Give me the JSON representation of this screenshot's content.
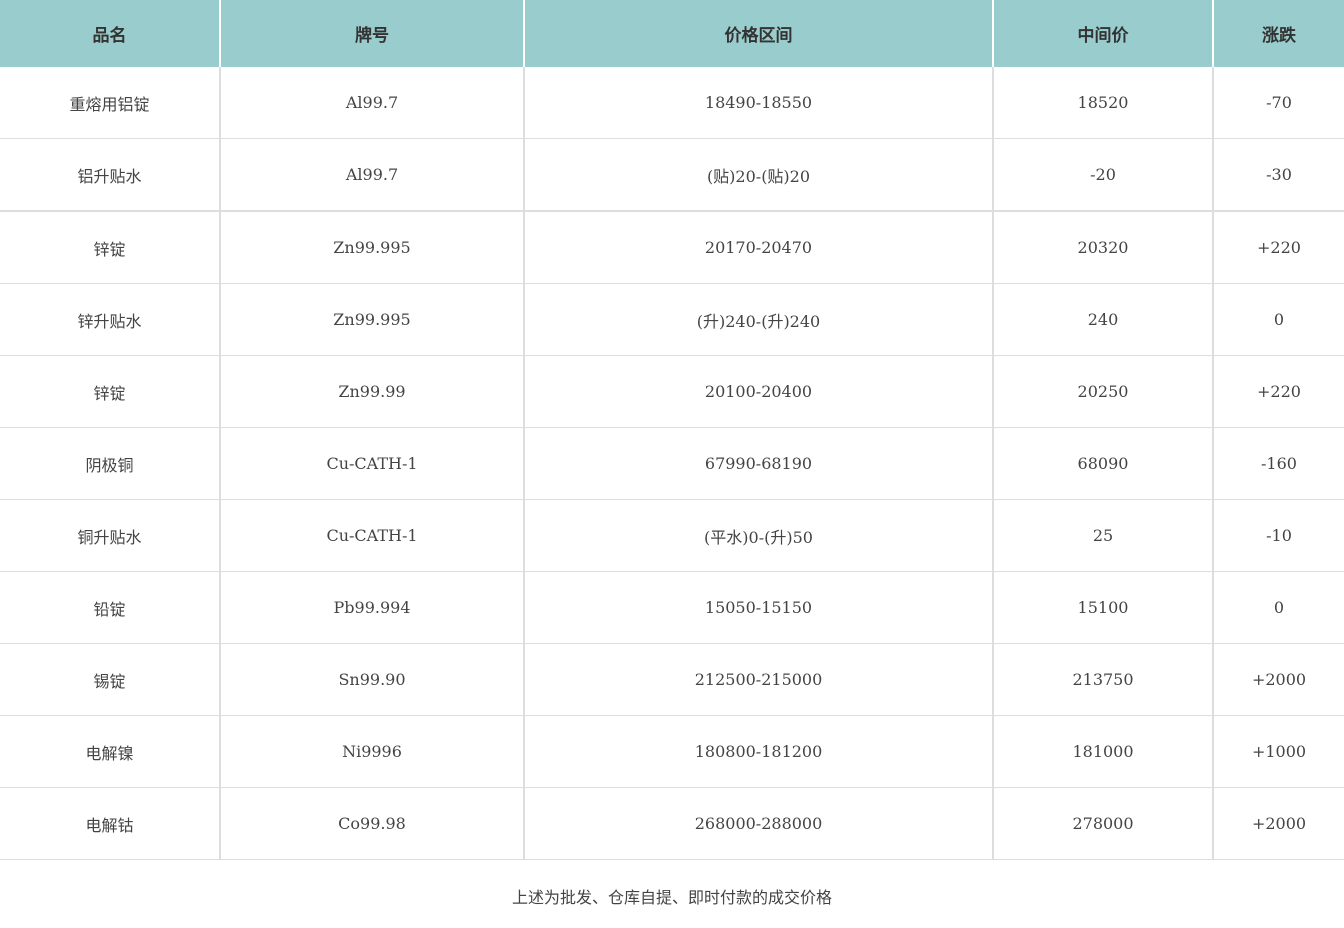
{
  "table": {
    "headers": [
      "品名",
      "牌号",
      "价格区间",
      "中间价",
      "涨跌"
    ],
    "rows": [
      [
        "重熔用铝锭",
        "Al99.7",
        "18490-18550",
        "18520",
        "-70"
      ],
      [
        "铝升贴水",
        "Al99.7",
        "(贴)20-(贴)20",
        "-20",
        "-30"
      ],
      [
        "锌锭",
        "Zn99.995",
        "20170-20470",
        "20320",
        "+220"
      ],
      [
        "锌升贴水",
        "Zn99.995",
        "(升)240-(升)240",
        "240",
        "0"
      ],
      [
        "锌锭",
        "Zn99.99",
        "20100-20400",
        "20250",
        "+220"
      ],
      [
        "阴极铜",
        "Cu-CATH-1",
        "67990-68190",
        "68090",
        "-160"
      ],
      [
        "铜升贴水",
        "Cu-CATH-1",
        "(平水)0-(升)50",
        "25",
        "-10"
      ],
      [
        "铅锭",
        "Pb99.994",
        "15050-15150",
        "15100",
        "0"
      ],
      [
        "锡锭",
        "Sn99.90",
        "212500-215000",
        "213750",
        "+2000"
      ],
      [
        "电解镍",
        "Ni9996",
        "180800-181200",
        "181000",
        "+1000"
      ],
      [
        "电解钴",
        "Co99.98",
        "268000-288000",
        "278000",
        "+2000"
      ]
    ]
  },
  "footer": {
    "note": "上述为批发、仓库自提、即时付款的成交价格"
  },
  "colors": {
    "header_bg": "#99cccc",
    "border": "#dddddd",
    "text": "#444444"
  }
}
